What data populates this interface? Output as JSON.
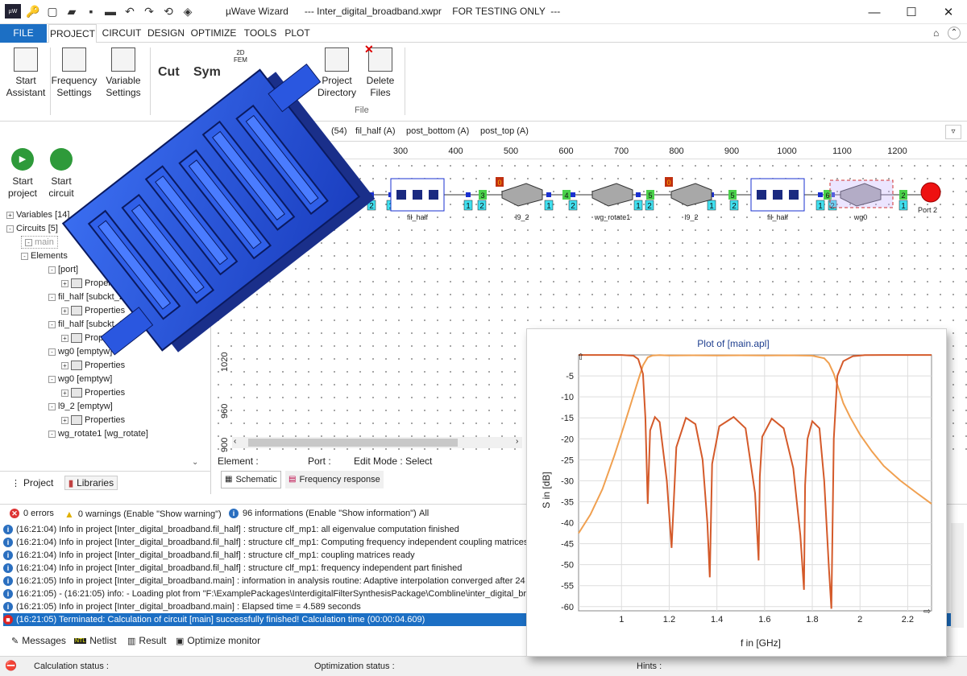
{
  "titlebar": {
    "app": "µWave Wizard",
    "doc": "--- Inter_digital_broadband.xwpr    FOR TESTING ONLY  ---",
    "min_glyph": "—",
    "max_glyph": "☐",
    "close_glyph": "✕"
  },
  "menu": {
    "file": "FILE",
    "tabs": [
      "PROJECT",
      "CIRCUIT",
      "DESIGN",
      "OPTIMIZE",
      "TOOLS",
      "PLOT"
    ]
  },
  "ribbon": {
    "start_assistant": [
      "Start",
      "Assistant"
    ],
    "frequency_settings": [
      "Frequency",
      "Settings"
    ],
    "variable_settings": [
      "Variable",
      "Settings"
    ],
    "cut": "Cut",
    "sym": "Sym",
    "fem_label": [
      "2D",
      "FEM"
    ],
    "project_directory": [
      "Project",
      "Directory"
    ],
    "delete_files": [
      "Delete",
      "Files"
    ],
    "group_file": "File"
  },
  "left_panel": {
    "start_project": [
      "Start",
      "project"
    ],
    "start_circuit": [
      "Start",
      "circuit"
    ],
    "tree": [
      {
        "label": "Variables [14]",
        "level": 0,
        "exp": "+"
      },
      {
        "label": "Circuits [5]",
        "level": 0,
        "exp": "-"
      },
      {
        "label": "main",
        "level": 1,
        "exp": "-"
      },
      {
        "label": "Elements",
        "level": 2,
        "exp": "-"
      },
      {
        "label": "[port]",
        "level": 4,
        "exp": "-"
      },
      {
        "label": "Properties",
        "level": 5,
        "exp": "+",
        "prop": true
      },
      {
        "label": "fil_half [subckt_2]",
        "level": 4,
        "exp": "-"
      },
      {
        "label": "Properties",
        "level": 5,
        "exp": "+",
        "prop": true
      },
      {
        "label": "fil_half [subckt_2]",
        "level": 4,
        "exp": "-"
      },
      {
        "label": "Properties",
        "level": 5,
        "exp": "+",
        "prop": true
      },
      {
        "label": "wg0 [emptyw]",
        "level": 4,
        "exp": "-"
      },
      {
        "label": "Properties",
        "level": 5,
        "exp": "+",
        "prop": true
      },
      {
        "label": "wg0 [emptyw]",
        "level": 4,
        "exp": "-"
      },
      {
        "label": "Properties",
        "level": 5,
        "exp": "+",
        "prop": true
      },
      {
        "label": "l9_2 [emptyw]",
        "level": 4,
        "exp": "-"
      },
      {
        "label": "Properties",
        "level": 5,
        "exp": "+",
        "prop": true
      },
      {
        "label": "wg_rotate1 [wg_rotate]",
        "level": 4,
        "exp": "-"
      }
    ],
    "tab_project": "Project",
    "tab_libraries": "Libraries"
  },
  "doc_tabs": [
    "(54)",
    "fil_half (A)",
    "post_bottom (A)",
    "post_top (A)"
  ],
  "ruler": [
    "300",
    "400",
    "500",
    "600",
    "700",
    "800",
    "900",
    "1000",
    "1100",
    "1200"
  ],
  "y_ruler": [
    "1020",
    "960",
    "900"
  ],
  "schematic": {
    "elements": [
      "fil_half",
      "l9_2",
      "wg_rotate1",
      "l9_2",
      "fil_half",
      "wg0"
    ],
    "port2": "Port 2",
    "node_labels": [
      "2",
      "1",
      "2",
      "1",
      "2",
      "1",
      "2",
      "1",
      "2",
      "1",
      "2",
      "1",
      "2",
      "1"
    ],
    "green_labels": [
      "3",
      "3",
      "4",
      "5",
      "7",
      "5",
      "6",
      "2"
    ],
    "red_markers": [
      "0",
      "0"
    ]
  },
  "status_row": {
    "element": "Element :",
    "port": "Port :",
    "edit_mode": "Edit Mode :  Select"
  },
  "view_tabs": {
    "schematic": "Schematic",
    "freq": "Frequency response"
  },
  "msgbar": {
    "errors": "0 errors",
    "warnings": "0 warnings (Enable \"Show warning\")",
    "infos": "96 informations (Enable \"Show information\")",
    "all": "All"
  },
  "log": [
    "(16:21:04)  Info in project [Inter_digital_broadband.fil_half] : structure clf_mp1: all eigenvalue computation finished",
    "(16:21:04)  Info in project [Inter_digital_broadband.fil_half] : structure clf_mp1: Computing frequency independent coupling matrices",
    "(16:21:04)  Info in project [Inter_digital_broadband.fil_half] : structure clf_mp1: coupling matrices ready",
    "(16:21:04)  Info in project [Inter_digital_broadband.fil_half] : structure clf_mp1: frequency independent part finished",
    "(16:21:05)  Info in project [Inter_digital_broadband.main] : information in analysis routine: Adaptive interpolation converged after 24 of 1",
    "(16:21:05) - (16:21:05)  info:     - Loading plot from \"F:\\ExamplePackages\\InterdigitalFilterSynthesisPackage\\Combline\\inter_digital_bro",
    "(16:21:05)  Info in project [Inter_digital_broadband.main] : Elapsed time = 4.589 seconds",
    "(16:21:05)  Terminated: Calculation of circuit [main] successfully finished!  Calculation time (00:00:04.609)"
  ],
  "bottom_tabs": [
    "Messages",
    "Netlist",
    "Result",
    "Optimize monitor"
  ],
  "netlist_icon": "NTL",
  "statusbar": {
    "calc": "Calculation status :",
    "opt": "Optimization status :",
    "hints": "Hints :"
  },
  "chart_data": {
    "type": "line",
    "title": "Plot of [main.apl]",
    "xlabel": "f in [GHz]",
    "ylabel": "S in [dB]",
    "xlim": [
      0.82,
      2.3
    ],
    "ylim": [
      -61,
      0
    ],
    "xticks": [
      "1",
      "1.2",
      "1.4",
      "1.6",
      "1.8",
      "2",
      "2.2"
    ],
    "yticks": [
      "-5",
      "-10",
      "-15",
      "-20",
      "-25",
      "-30",
      "-35",
      "-40",
      "-45",
      "-50",
      "-55",
      "-60"
    ],
    "grid": true,
    "series": [
      {
        "color": "#d45a2a",
        "x": [
          0.82,
          0.9,
          1.0,
          1.05,
          1.07,
          1.09,
          1.1,
          1.11,
          1.12,
          1.14,
          1.16,
          1.19,
          1.21,
          1.23,
          1.27,
          1.31,
          1.34,
          1.36,
          1.37,
          1.38,
          1.41,
          1.47,
          1.52,
          1.56,
          1.575,
          1.58,
          1.59,
          1.63,
          1.68,
          1.72,
          1.75,
          1.765,
          1.77,
          1.78,
          1.8,
          1.83,
          1.85,
          1.87,
          1.88,
          1.89,
          1.905,
          1.93,
          1.97,
          2.02,
          2.1,
          2.3
        ],
        "y": [
          -0.01,
          -0.01,
          -0.02,
          -0.2,
          -1.0,
          -4.5,
          -15.0,
          -35.5,
          -18.0,
          -14.8,
          -16.0,
          -30.0,
          -46.0,
          -22.0,
          -15.0,
          -16.5,
          -25.0,
          -40.0,
          -53.0,
          -26.0,
          -17.0,
          -14.8,
          -17.5,
          -33.0,
          -49.0,
          -29.0,
          -19.5,
          -15.2,
          -17.5,
          -27.0,
          -43.0,
          -56.0,
          -31.0,
          -20.0,
          -15.8,
          -17.5,
          -30.0,
          -51.0,
          -60.5,
          -20.0,
          -5.0,
          -1.5,
          -0.3,
          -0.05,
          -0.01,
          -0.01
        ]
      },
      {
        "color": "#f0a050",
        "x": [
          0.82,
          0.87,
          0.92,
          0.97,
          1.01,
          1.04,
          1.07,
          1.09,
          1.11,
          1.13,
          1.16,
          1.2,
          1.3,
          1.4,
          1.5,
          1.6,
          1.7,
          1.8,
          1.85,
          1.87,
          1.89,
          1.91,
          1.93,
          1.96,
          2.0,
          2.05,
          2.1,
          2.17,
          2.24,
          2.3
        ],
        "y": [
          -42.5,
          -38.0,
          -32.0,
          -24.0,
          -17.0,
          -11.5,
          -6.0,
          -2.5,
          -0.6,
          -0.15,
          -0.05,
          -0.15,
          -0.1,
          -0.15,
          -0.1,
          -0.15,
          -0.1,
          -0.2,
          -0.8,
          -2.0,
          -4.5,
          -8.0,
          -11.5,
          -15.0,
          -19.0,
          -23.0,
          -26.5,
          -30.0,
          -33.0,
          -35.5
        ]
      }
    ]
  }
}
